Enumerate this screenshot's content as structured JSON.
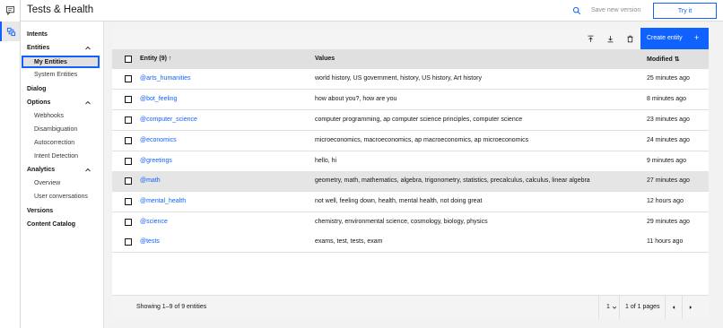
{
  "app": {
    "title": "Tests & Health",
    "save_version": "Save new version",
    "try_it": "Try it"
  },
  "sidebar": {
    "intents": "Intents",
    "entities": "Entities",
    "my_entities": "My Entities",
    "system_entities": "System Entities",
    "dialog": "Dialog",
    "options": "Options",
    "webhooks": "Webhooks",
    "disambiguation": "Disambiguation",
    "autocorrection": "Autocorrection",
    "intent_detection": "Intent Detection",
    "analytics": "Analytics",
    "overview": "Overview",
    "user_conversations": "User conversations",
    "versions": "Versions",
    "content_catalog": "Content Catalog"
  },
  "toolbar": {
    "create_label": "Create entity",
    "plus": "+"
  },
  "table": {
    "headers": {
      "entity": "Entity (9)",
      "sort_asc": "↑",
      "values": "Values",
      "modified": "Modified",
      "sort_both": "⇅"
    },
    "rows": [
      {
        "entity": "@arts_humanities",
        "values": "world history, US government, history, US history, Art history",
        "modified": "25 minutes ago"
      },
      {
        "entity": "@bot_feeling",
        "values": "how about you?, how are you",
        "modified": "8 minutes ago"
      },
      {
        "entity": "@computer_science",
        "values": "computer programming, ap computer science principles, computer science",
        "modified": "23 minutes ago"
      },
      {
        "entity": "@economics",
        "values": "microeconomics, macroeconomics, ap macroeconomics, ap microeconomics",
        "modified": "24 minutes ago"
      },
      {
        "entity": "@greetings",
        "values": "hello, hi",
        "modified": "9 minutes ago"
      },
      {
        "entity": "@math",
        "values": "geometry, math, mathematics, algebra, trigonometry, statistics, precalculus, calculus, linear algebra",
        "modified": "27 minutes ago"
      },
      {
        "entity": "@mental_health",
        "values": "not well, feeling down, health, mental health, not doing great",
        "modified": "12 hours ago"
      },
      {
        "entity": "@science",
        "values": "chemistry, environmental science, cosmology, biology, physics",
        "modified": "29 minutes ago"
      },
      {
        "entity": "@tests",
        "values": "exams, test, tests, exam",
        "modified": "11 hours ago"
      }
    ]
  },
  "footer": {
    "showing": "Showing 1–9 of 9 entities",
    "page": "1",
    "page_of": "1 of 1 pages"
  },
  "icons": {
    "accent": "#0f62fe"
  }
}
